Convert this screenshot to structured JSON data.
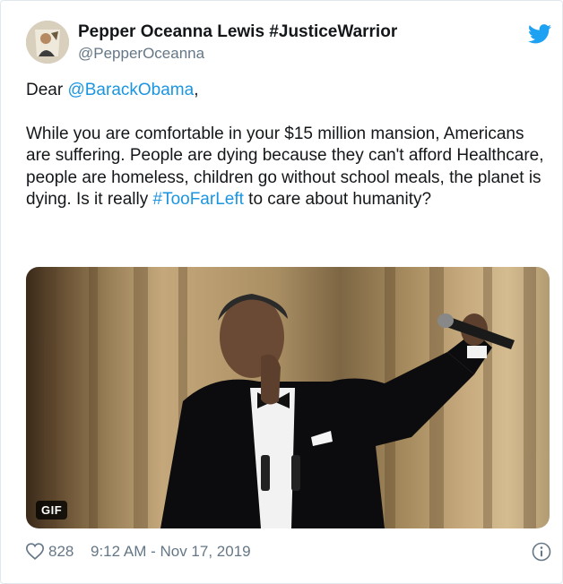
{
  "author": {
    "display_name": "Pepper Oceanna Lewis #JusticeWarrior",
    "handle": "@PepperOceanna"
  },
  "tweet": {
    "greeting_prefix": "Dear ",
    "mention": "@BarackObama",
    "greeting_suffix": ",",
    "body_text": "While you are comfortable in your $15 million mansion, Americans are suffering. People are dying because they can't afford Healthcare, people are homeless, children go without school meals, the planet is dying. Is it really ",
    "hashtag": "#TooFarLeft",
    "body_suffix": " to care about humanity?"
  },
  "media": {
    "badge": "GIF"
  },
  "footer": {
    "like_count": "828",
    "timestamp": "9:12 AM - Nov 17, 2019"
  },
  "colors": {
    "link": "#1b95e0",
    "secondary_text": "#657786",
    "twitter_blue": "#1da1f2",
    "border": "#e1e8ed"
  },
  "icons": {
    "brand": "twitter-bird-icon",
    "like": "heart-icon",
    "info": "info-icon"
  }
}
